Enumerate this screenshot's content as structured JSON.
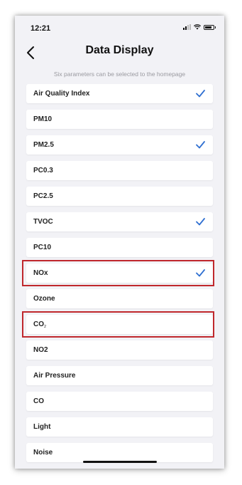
{
  "status_bar": {
    "time": "12:21"
  },
  "header": {
    "title": "Data Display"
  },
  "hint": "Six parameters can be selected to the homepage",
  "accent_color": "#2f6fd1",
  "highlight_color": "#c0282d",
  "items": [
    {
      "label": "Air Quality Index",
      "checked": true
    },
    {
      "label": "PM10",
      "checked": false
    },
    {
      "label": "PM2.5",
      "checked": true
    },
    {
      "label": "PC0.3",
      "checked": false
    },
    {
      "label": "PC2.5",
      "checked": false
    },
    {
      "label": "TVOC",
      "checked": true
    },
    {
      "label": "PC10",
      "checked": false
    },
    {
      "label": "NOx",
      "checked": true,
      "highlighted": true
    },
    {
      "label": "Ozone",
      "checked": false
    },
    {
      "label": "CO",
      "label_sub": "2",
      "checked": false,
      "highlighted": true
    },
    {
      "label": "NO2",
      "checked": false
    },
    {
      "label": "Air Pressure",
      "checked": false
    },
    {
      "label": "CO",
      "checked": false
    },
    {
      "label": "Light",
      "checked": false
    },
    {
      "label": "Noise",
      "checked": false
    }
  ]
}
